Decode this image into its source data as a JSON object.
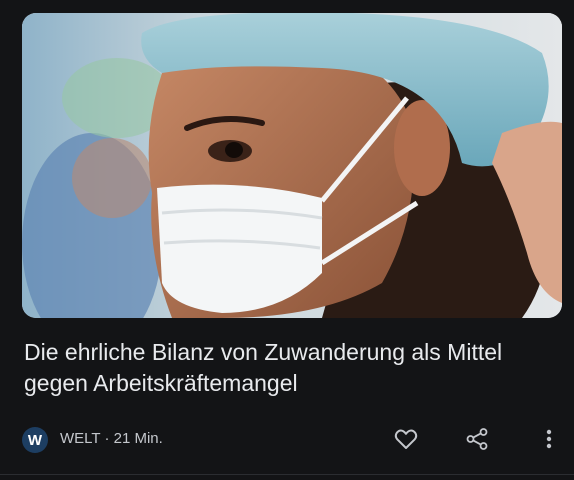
{
  "article": {
    "headline": "Die ehrliche Bilanz von Zuwanderung als Mittel gegen Arbeitskräftemangel",
    "source": {
      "logo_letter": "W",
      "meta": "WELT · 21 Min."
    },
    "image_alt": "Pflegekraft mit Haube und Mundschutz"
  },
  "icons": {
    "favorite": "heart-outline-icon",
    "share": "share-icon",
    "more": "more-vertical-icon"
  },
  "colors": {
    "background": "#131416",
    "text": "#e8eaed",
    "logo_bg": "#1d3e62"
  }
}
